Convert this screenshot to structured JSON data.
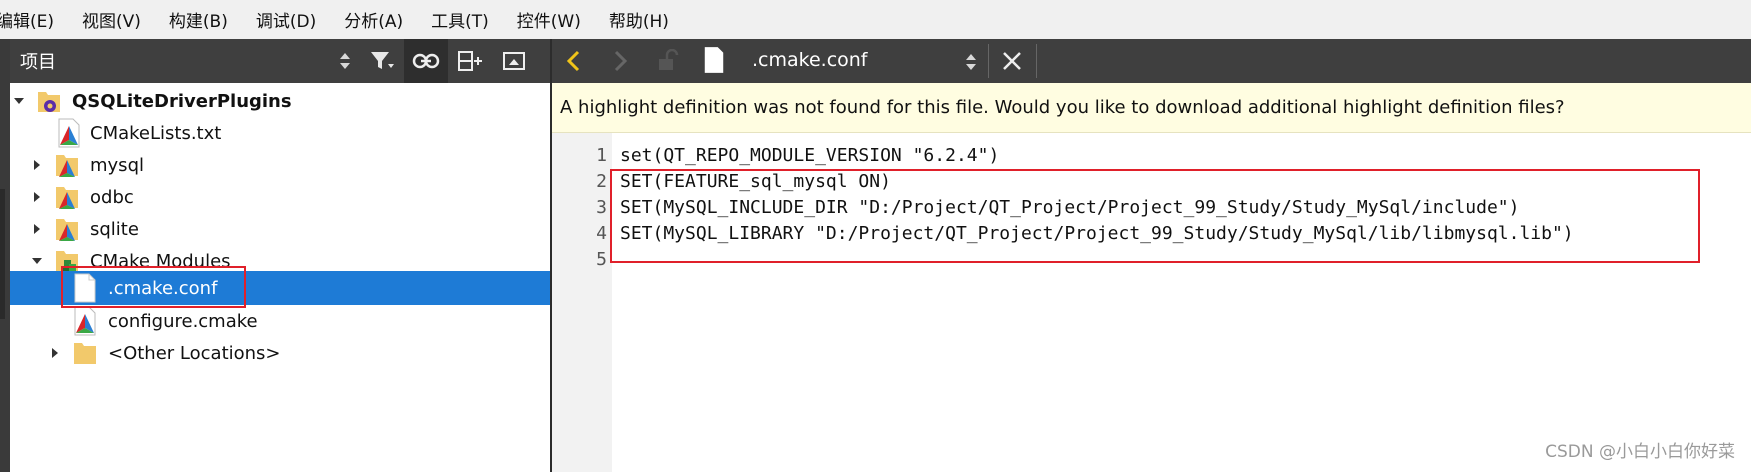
{
  "menu": [
    "编辑(E)",
    "视图(V)",
    "构建(B)",
    "调试(D)",
    "分析(A)",
    "工具(T)",
    "控件(W)",
    "帮助(H)"
  ],
  "projects_panel": {
    "title": "项目"
  },
  "tree": [
    {
      "label": "QSQLiteDriverPlugins",
      "bold": true,
      "expanded": true,
      "icon": "cmake-project-icon"
    },
    {
      "label": "CMakeLists.txt",
      "icon": "cmake-file-icon"
    },
    {
      "label": "mysql",
      "collapsed": true,
      "icon": "cmake-folder-icon"
    },
    {
      "label": "odbc",
      "collapsed": true,
      "icon": "cmake-folder-icon"
    },
    {
      "label": "sqlite",
      "collapsed": true,
      "icon": "cmake-folder-icon"
    },
    {
      "label": "CMake Modules",
      "expanded": true,
      "icon": "cmake-modules-folder-icon"
    },
    {
      "label": ".cmake.conf",
      "selected": true,
      "icon": "blank-file-icon"
    },
    {
      "label": "configure.cmake",
      "icon": "cmake-file-icon"
    },
    {
      "label": "<Other Locations>",
      "collapsed": true,
      "icon": "folder-icon"
    }
  ],
  "editor": {
    "file_name": ".cmake.conf",
    "info_message": "A highlight definition was not found for this file. Would you like to download additional highlight definition files?",
    "line_numbers": [
      "1",
      "2",
      "3",
      "4",
      "5"
    ],
    "lines": [
      "set(QT_REPO_MODULE_VERSION \"6.2.4\")",
      "SET(FEATURE_sql_mysql ON)",
      "SET(MySQL_INCLUDE_DIR \"D:/Project/QT_Project/Project_99_Study/Study_MySql/include\")",
      "SET(MySQL_LIBRARY \"D:/Project/QT_Project/Project_99_Study/Study_MySql/lib/libmysql.lib\")",
      ""
    ]
  },
  "watermark": "CSDN @小白小白你好菜",
  "colors": {
    "selection": "#1e7bd6",
    "toolbar": "#3f3f3f",
    "info_bar": "#fffde1",
    "annotation": "#e0202a",
    "back_arrow": "#f0c419"
  }
}
